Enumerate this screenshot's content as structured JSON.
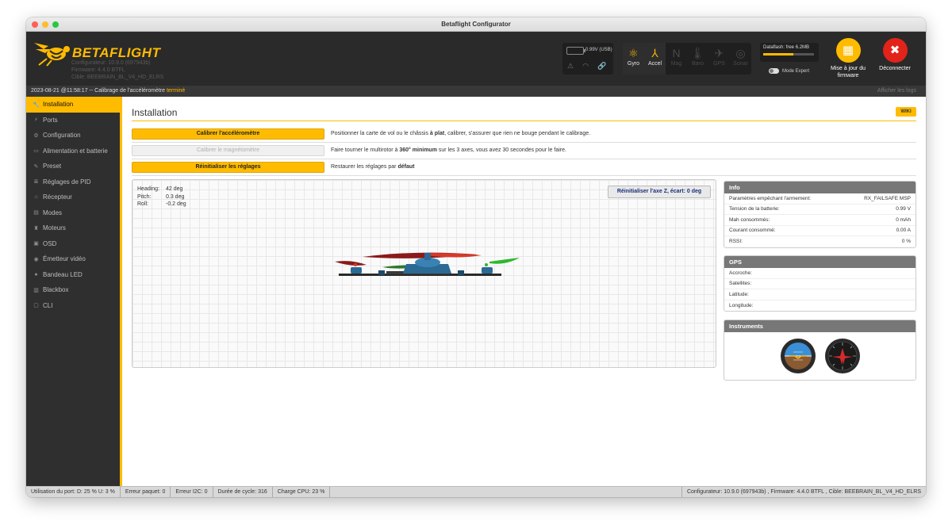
{
  "window": {
    "title": "Betaflight Configurator"
  },
  "header": {
    "brand": "BETAFLIGHT",
    "configurator": "Configurateur: 10.9.0 (697943b)",
    "firmware": "Firmware: 4.4.0 BTFL",
    "target": "Cible: BEEBRAIN_BL_V4_HD_ELRS",
    "battery_text": "0.99V (USB)",
    "sensors": [
      {
        "label": "Gyro",
        "icon": "gyro-icon",
        "active": true
      },
      {
        "label": "Accel",
        "icon": "accel-icon",
        "active": true
      },
      {
        "label": "Mag",
        "icon": "mag-icon",
        "active": false
      },
      {
        "label": "Baro",
        "icon": "baro-icon",
        "active": false
      },
      {
        "label": "GPS",
        "icon": "gps-icon",
        "active": false
      },
      {
        "label": "Sonar",
        "icon": "sonar-icon",
        "active": false
      }
    ],
    "dataflash_text": "Dataflash: free 6.2MB",
    "dataflash_free_fraction": 0.6,
    "expert_mode": "Mode Expert",
    "update_firmware": "Mise à jour du firmware",
    "disconnect": "Déconnecter"
  },
  "logbar": {
    "message": "2023-08-21 @11:58:17 -- Calibrage de l'accéléromètre ",
    "status": "terminé",
    "show_logs": "Afficher les logs"
  },
  "tabs": [
    {
      "label": "Installation",
      "icon": "wrench-icon",
      "glyph": "🔧",
      "active": true
    },
    {
      "label": "Ports",
      "icon": "plug-icon",
      "glyph": "⚡",
      "active": false
    },
    {
      "label": "Configuration",
      "icon": "gear-icon",
      "glyph": "⚙",
      "active": false
    },
    {
      "label": "Alimentation et batterie",
      "icon": "battery-icon",
      "glyph": "▭",
      "active": false
    },
    {
      "label": "Preset",
      "icon": "preset-icon",
      "glyph": "✎",
      "active": false
    },
    {
      "label": "Réglages de PID",
      "icon": "pid-icon",
      "glyph": "≣",
      "active": false
    },
    {
      "label": "Récepteur",
      "icon": "receiver-icon",
      "glyph": "⌂",
      "active": false
    },
    {
      "label": "Modes",
      "icon": "modes-icon",
      "glyph": "▤",
      "active": false
    },
    {
      "label": "Moteurs",
      "icon": "motor-icon",
      "glyph": "♜",
      "active": false
    },
    {
      "label": "OSD",
      "icon": "osd-icon",
      "glyph": "▣",
      "active": false
    },
    {
      "label": "Émetteur vidéo",
      "icon": "vtx-icon",
      "glyph": "◉",
      "active": false
    },
    {
      "label": "Bandeau LED",
      "icon": "led-icon",
      "glyph": "●",
      "active": false
    },
    {
      "label": "Blackbox",
      "icon": "blackbox-icon",
      "glyph": "▥",
      "active": false
    },
    {
      "label": "CLI",
      "icon": "cli-icon",
      "glyph": "▢",
      "active": false
    }
  ],
  "main": {
    "title": "Installation",
    "wiki": "WIKI",
    "actions": [
      {
        "button": "Calibrer l'accéléromètre",
        "disabled": false,
        "desc_parts": [
          "Positionner la carte de vol ou le châssis ",
          "à plat",
          ", calibrer, s'assurer que rien ne bouge pendant le calibrage."
        ]
      },
      {
        "button": "Calibrer le magnétomètre",
        "disabled": true,
        "desc_parts": [
          "Faire tourner le multirotor à ",
          "360° minimum",
          " sur les 3 axes, vous avez 30 secondes pour le faire."
        ]
      },
      {
        "button": "Réinitialiser les réglages",
        "disabled": false,
        "desc_parts": [
          "Restaurer les réglages par ",
          "défaut",
          ""
        ]
      }
    ],
    "attitude": {
      "heading_label": "Heading:",
      "heading_value": "42 deg",
      "pitch_label": "Pitch:",
      "pitch_value": "0.3 deg",
      "roll_label": "Roll:",
      "roll_value": "-0.2 deg"
    },
    "reset_z": "Réinitialiser l'axe Z, écart: 0 deg"
  },
  "info": {
    "title": "Info",
    "rows": [
      {
        "label": "Paramètres empêchant l'armement:",
        "value": "RX_FAILSAFE  MSP"
      },
      {
        "label": "Tension de la batterie:",
        "value": "0.99 V"
      },
      {
        "label": "Mah consommés:",
        "value": "0 mAh"
      },
      {
        "label": "Courant consommé:",
        "value": "0.00 A"
      },
      {
        "label": "RSSI:",
        "value": "0 %"
      }
    ]
  },
  "gps": {
    "title": "GPS",
    "rows": [
      {
        "label": "Accroche:",
        "value": ""
      },
      {
        "label": "Satellites:",
        "value": ""
      },
      {
        "label": "Latitude:",
        "value": ""
      },
      {
        "label": "Longitude:",
        "value": ""
      }
    ]
  },
  "instruments": {
    "title": "Instruments"
  },
  "statusbar": {
    "port": "Utilisation du port: D: 25 % U: 3 %",
    "packet_error": "Erreur paquet: 0",
    "i2c_error": "Erreur I2C: 0",
    "cycle": "Durée de cycle: 316",
    "cpu": "Charge CPU: 23 %",
    "right": "Configurateur: 10.9.0 (697943b) , Firmware: 4.4.0 BTFL , Cible: BEEBRAIN_BL_V4_HD_ELRS"
  }
}
